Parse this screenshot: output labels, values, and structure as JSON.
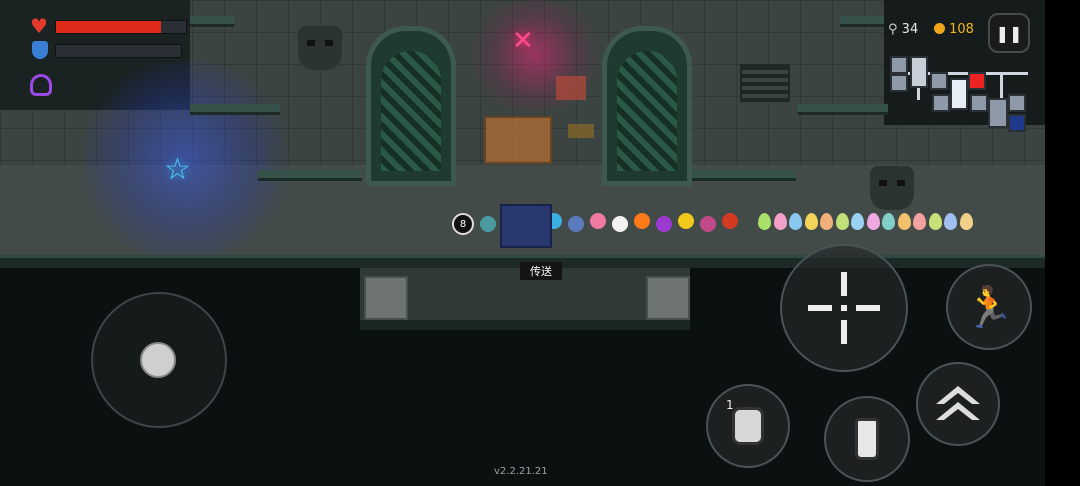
{
  "hud": {
    "health_icon": "heart-icon",
    "shield_icon": "shield-icon",
    "skill_icon": "hooded-skill-icon",
    "health_fill": 0.81,
    "shield_fill": 0.0,
    "health_color": "#e02a1a",
    "shield_color": "#3a7fd6",
    "keys_icon": "key-icon",
    "keys": "34",
    "coins_icon": "coin-icon",
    "coins": "108",
    "pause_icon": "pause-icon"
  },
  "scene": {
    "teleport_label": "传送",
    "pet_count_label": "8",
    "pets": [
      {
        "name": "robot-pet",
        "color": "#4a9aa0"
      },
      {
        "name": "dark-knight",
        "color": "#263a7a"
      },
      {
        "name": "cat-pet",
        "color": "#e8e8e8"
      },
      {
        "name": "fish-pet",
        "color": "#3ab0e0"
      },
      {
        "name": "blue-goblin",
        "color": "#5a7ac0"
      },
      {
        "name": "pink-pet",
        "color": "#f07aa0"
      },
      {
        "name": "panda-pet",
        "color": "#f2f2f2"
      },
      {
        "name": "fire-pet",
        "color": "#ff7a1a"
      },
      {
        "name": "purple-pet",
        "color": "#9a3ad0"
      },
      {
        "name": "yellow-pet",
        "color": "#f2c81a"
      },
      {
        "name": "flower-pet",
        "color": "#c04a8a"
      },
      {
        "name": "red-teapot",
        "color": "#d23a22"
      }
    ],
    "eggs": [
      "#a8e06a",
      "#f2a0c8",
      "#8ac8f0",
      "#f2d45a",
      "#f2b07a",
      "#c0e07a",
      "#9ad0f0",
      "#f0a8e0",
      "#80d0c8",
      "#f2c06a",
      "#f2a0a0",
      "#c8e07a",
      "#a0c0f0",
      "#f2d08a"
    ]
  },
  "minimap": {
    "boss_icon": "boss-skull-icon",
    "portal_icon": "portal-icon"
  },
  "controls": {
    "joystick": "movement-joystick",
    "attack_icon": "crosshair-icon",
    "dash_icon": "running-man-icon",
    "grenade_icon": "grenade-icon",
    "grenade_count": "1",
    "item_icon": "bottle-icon",
    "jump_icon": "double-chevron-up-icon"
  },
  "version": "v2.2.21.21"
}
